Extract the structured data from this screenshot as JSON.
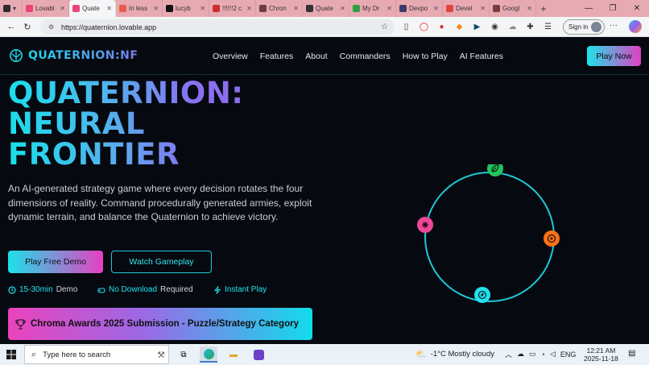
{
  "browser": {
    "tabs": [
      {
        "label": "",
        "color": "#2b2b2b"
      },
      {
        "label": "Lovabl",
        "color": "#e8447a"
      },
      {
        "label": "Quate",
        "color": "#e8447a",
        "active": true
      },
      {
        "label": "In less",
        "color": "#e85d4a"
      },
      {
        "label": "lucyb",
        "color": "#111111"
      },
      {
        "label": "!!!!!!2 c",
        "color": "#cc2d2d"
      },
      {
        "label": "Chron",
        "color": "#6b3d3d"
      },
      {
        "label": "Quate",
        "color": "#333333"
      },
      {
        "label": "My Dr",
        "color": "#2ea043"
      },
      {
        "label": "Devpo",
        "color": "#3b3b6b"
      },
      {
        "label": "Devel",
        "color": "#e0443f"
      },
      {
        "label": "Googl",
        "color": "#7b3b3b"
      }
    ],
    "new_tab": "+",
    "url": "https://quaternion.lovable.app",
    "signin_label": "Sign in"
  },
  "site": {
    "brand": "QUATERNION:NF",
    "nav": [
      "Overview",
      "Features",
      "About",
      "Commanders",
      "How to Play",
      "AI Features"
    ],
    "play_now": "Play Now",
    "title_lines": [
      "QUATERNION:",
      "NEURAL",
      "FRONTIER"
    ],
    "description": "An AI-generated strategy game where every decision rotates the four dimensions of reality. Command procedurally generated armies, exploit dynamic terrain, and balance the Quaternion to achieve victory.",
    "btn_demo": "Play Free Demo",
    "btn_watch": "Watch Gameplay",
    "features": [
      {
        "highlight": "15-30min",
        "rest": "Demo"
      },
      {
        "highlight": "No Download",
        "rest": "Required"
      },
      {
        "highlight": "Instant Play",
        "rest": ""
      }
    ],
    "award": "Chroma Awards 2025 Submission - Puzzle/Strategy Category",
    "orbit_nodes": [
      {
        "icon": "leaf-icon",
        "color": "#22c55e"
      },
      {
        "icon": "target-icon",
        "color": "#f97316"
      },
      {
        "icon": "compass-icon",
        "color": "#22e2ee"
      },
      {
        "icon": "atom-icon",
        "color": "#ec4899"
      }
    ]
  },
  "taskbar": {
    "search_placeholder": "Type here to search",
    "weather": "-1°C  Mostly cloudy",
    "lang": "ENG",
    "time": "12:21 AM",
    "date": "2025-11-18"
  }
}
